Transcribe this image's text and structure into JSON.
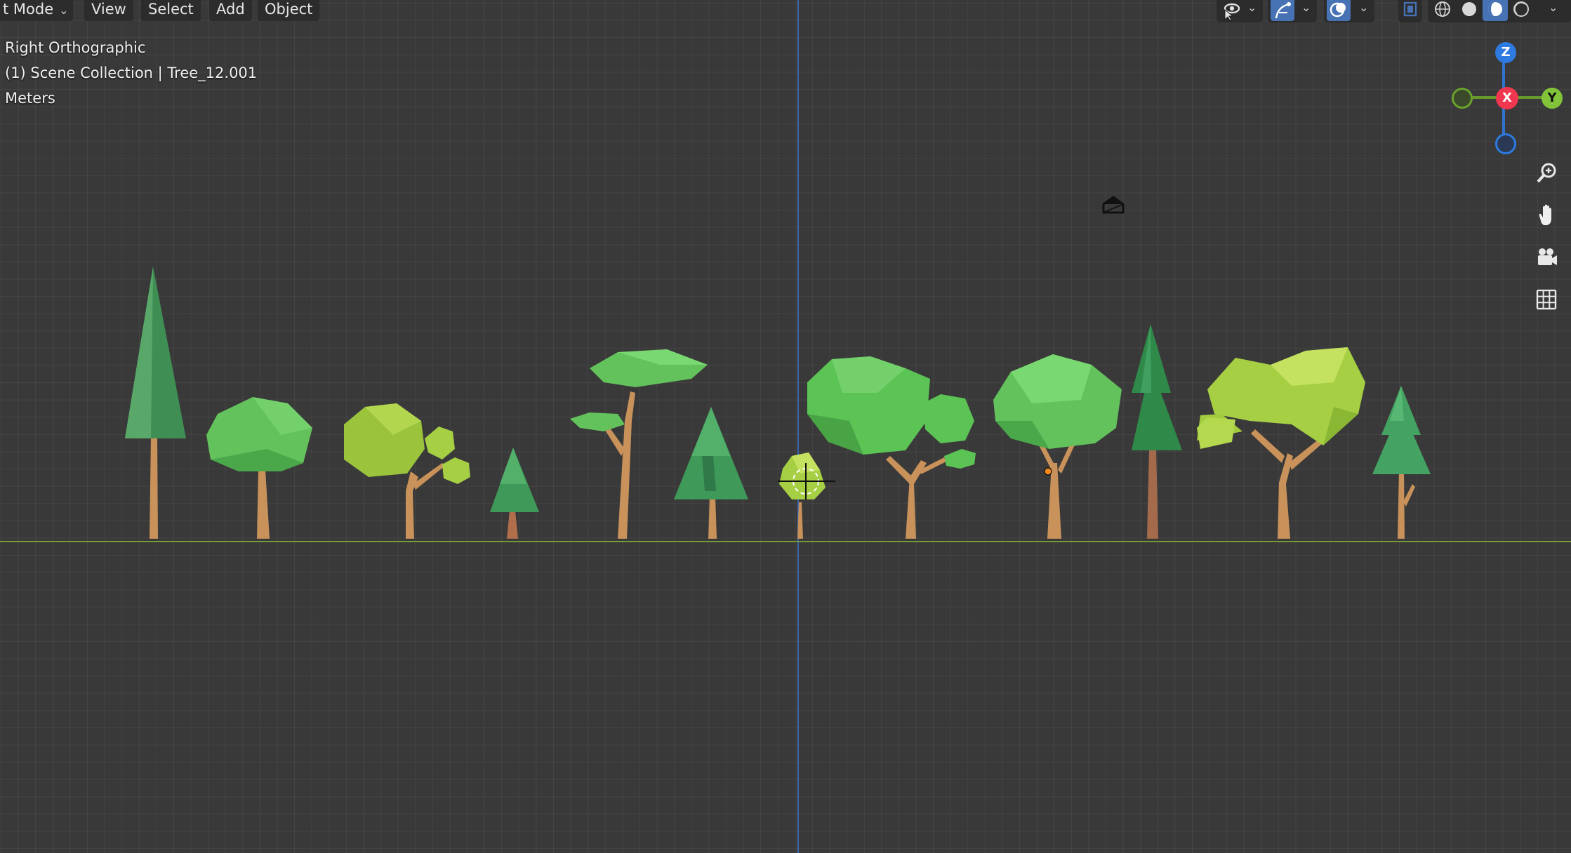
{
  "header": {
    "mode_label": "t Mode",
    "menus": [
      "View",
      "Select",
      "Add",
      "Object"
    ]
  },
  "overlay": {
    "view_name": "Right Orthographic",
    "collection_info": "(1) Scene Collection | Tree_12.001",
    "units": "Meters"
  },
  "gizmo": {
    "z_label": "Z",
    "x_label": "X",
    "y_label": "Y",
    "z_color": "#2d7ae0",
    "x_color": "#f0374f",
    "y_color": "#83c33a"
  },
  "navigation": {
    "buttons": [
      "zoom-icon",
      "hand-pan-icon",
      "camera-icon",
      "grid-ortho-icon"
    ]
  },
  "header_tools": [
    "visibility-icon",
    "gizmo-toggle-icon",
    "overlay-icon",
    "xray-icon",
    "wireframe-shading-icon",
    "solid-shading-icon",
    "material-shading-icon",
    "rendered-shading-icon"
  ],
  "colors": {
    "background": "#393939",
    "x_axis_line": "#7fa636",
    "y_axis_line": "#3b6fc4",
    "trunk": "#c8925a",
    "leaf_green": "#5cc95c",
    "leaf_dark": "#3f9a5a",
    "leaf_lime": "#a8d246"
  }
}
